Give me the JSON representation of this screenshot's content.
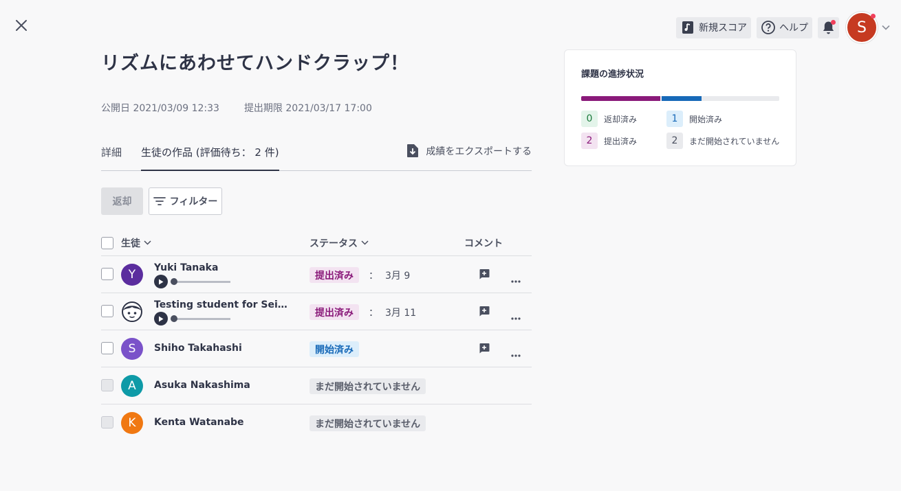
{
  "header": {
    "new_score_label": "新規スコア",
    "help_label": "ヘルプ",
    "user_initial": "S",
    "colors": {
      "notification": "#f0405c",
      "avatar": "#c63a21"
    }
  },
  "assignment": {
    "title": "リズムにあわせてハンドクラップ！",
    "published": "公開日 2021/03/09 12:33",
    "deadline": "提出期限 2021/03/17 17:00"
  },
  "tabs": [
    {
      "label": "詳細",
      "active": false
    },
    {
      "label": "生徒の作品 (評価待ち： 2 件)",
      "active": true
    }
  ],
  "export_label": "成績をエクスポートする",
  "toolbar": {
    "return_label": "返却",
    "filter_label": "フィルター"
  },
  "table": {
    "headers": {
      "student": "生徒",
      "status": "ステータス",
      "comment": "コメント"
    },
    "rows": [
      {
        "initial": "Y",
        "avatar_color": "#5b2d9e",
        "name": "Yuki Tanaka",
        "has_audio": true,
        "audio_progress": 0,
        "status": "提出済み",
        "status_type": "submitted",
        "sep": "：",
        "date": "3月 9",
        "has_actions": true,
        "checkbox_disabled": false
      },
      {
        "initial": "",
        "avatar_icon": "face-icon",
        "name": "Testing student for Seiji G...",
        "has_audio": true,
        "audio_progress": 0,
        "status": "提出済み",
        "status_type": "submitted",
        "sep": "：",
        "date": "3月 11",
        "has_actions": true,
        "checkbox_disabled": false
      },
      {
        "initial": "S",
        "avatar_color": "#7a52c9",
        "name": "Shiho Takahashi",
        "has_audio": false,
        "status": "開始済み",
        "status_type": "started",
        "date": "",
        "has_actions": true,
        "checkbox_disabled": false
      },
      {
        "initial": "A",
        "avatar_color": "#0e9aa7",
        "name": "Asuka Nakashima",
        "has_audio": false,
        "status": "まだ開始されていません",
        "status_type": "notstarted",
        "date": "",
        "has_actions": false,
        "checkbox_disabled": true
      },
      {
        "initial": "K",
        "avatar_color": "#f07812",
        "name": "Kenta Watanabe",
        "has_audio": false,
        "status": "まだ開始されていません",
        "status_type": "notstarted",
        "date": "",
        "has_actions": false,
        "checkbox_disabled": true
      }
    ]
  },
  "progress": {
    "title": "課題の進捗状況",
    "items": [
      {
        "count": "0",
        "label": "返却済み",
        "bg": "#e3f4ea",
        "fg": "#1c7a3c",
        "fraction": 0
      },
      {
        "count": "1",
        "label": "開始済み",
        "bg": "#dceefb",
        "fg": "#1769b8",
        "fraction": 0.2
      },
      {
        "count": "2",
        "label": "提出済み",
        "bg": "#f3e3f1",
        "fg": "#8a1a7a",
        "fraction": 0.4
      },
      {
        "count": "2",
        "label": "まだ開始されていません",
        "bg": "#e9eaed",
        "fg": "#4a4f5f",
        "fraction": 0.4
      }
    ],
    "bar": [
      {
        "fraction": 0.4,
        "color": "#8a1a7a"
      },
      {
        "fraction": 0.2,
        "color": "#1769b8"
      }
    ]
  }
}
